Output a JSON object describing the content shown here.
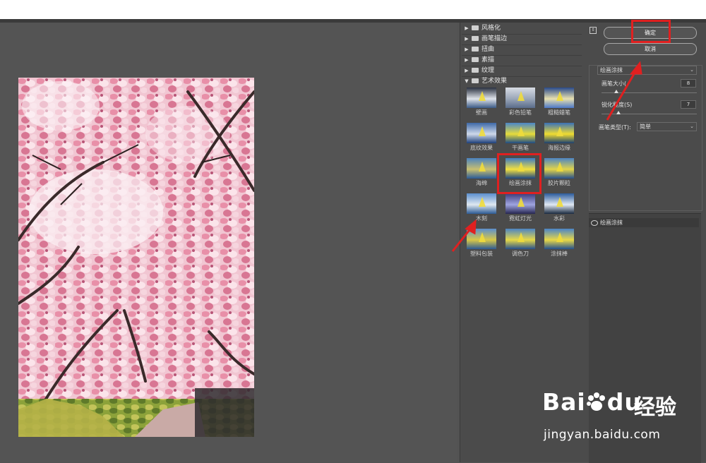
{
  "filter_categories": [
    {
      "label": "风格化",
      "expanded": false
    },
    {
      "label": "画笔描边",
      "expanded": false
    },
    {
      "label": "扭曲",
      "expanded": false
    },
    {
      "label": "素描",
      "expanded": false
    },
    {
      "label": "纹理",
      "expanded": false
    },
    {
      "label": "艺术效果",
      "expanded": true
    }
  ],
  "artistic_filters": [
    {
      "label": "壁画"
    },
    {
      "label": "彩色铅笔"
    },
    {
      "label": "粗糙蜡笔"
    },
    {
      "label": "底纹效果"
    },
    {
      "label": "干画笔"
    },
    {
      "label": "海报边缘"
    },
    {
      "label": "海绵"
    },
    {
      "label": "绘画涂抹",
      "selected": true
    },
    {
      "label": "胶片颗粒"
    },
    {
      "label": "木刻"
    },
    {
      "label": "霓虹灯光"
    },
    {
      "label": "水彩"
    },
    {
      "label": "塑料包装"
    },
    {
      "label": "调色刀"
    },
    {
      "label": "涂抹棒"
    }
  ],
  "buttons": {
    "ok": "确定",
    "cancel": "取消"
  },
  "options": {
    "filter_select": "绘画涂抹",
    "brush_size_label": "画笔大小(",
    "brush_size_value": "8",
    "sharpness_label": "锐化程度(S)",
    "sharpness_value": "7",
    "brush_type_label": "画笔类型(T):",
    "brush_type_value": "简单"
  },
  "applied_layer": {
    "name": "绘画涂抹"
  },
  "watermark": {
    "brand_left": "Bai",
    "brand_right": "du",
    "brand_cn": "经验",
    "url": "jingyan.baidu.com"
  },
  "colors": {
    "highlight": "#e02020",
    "panel": "#4b4b4b",
    "background": "#535353"
  }
}
